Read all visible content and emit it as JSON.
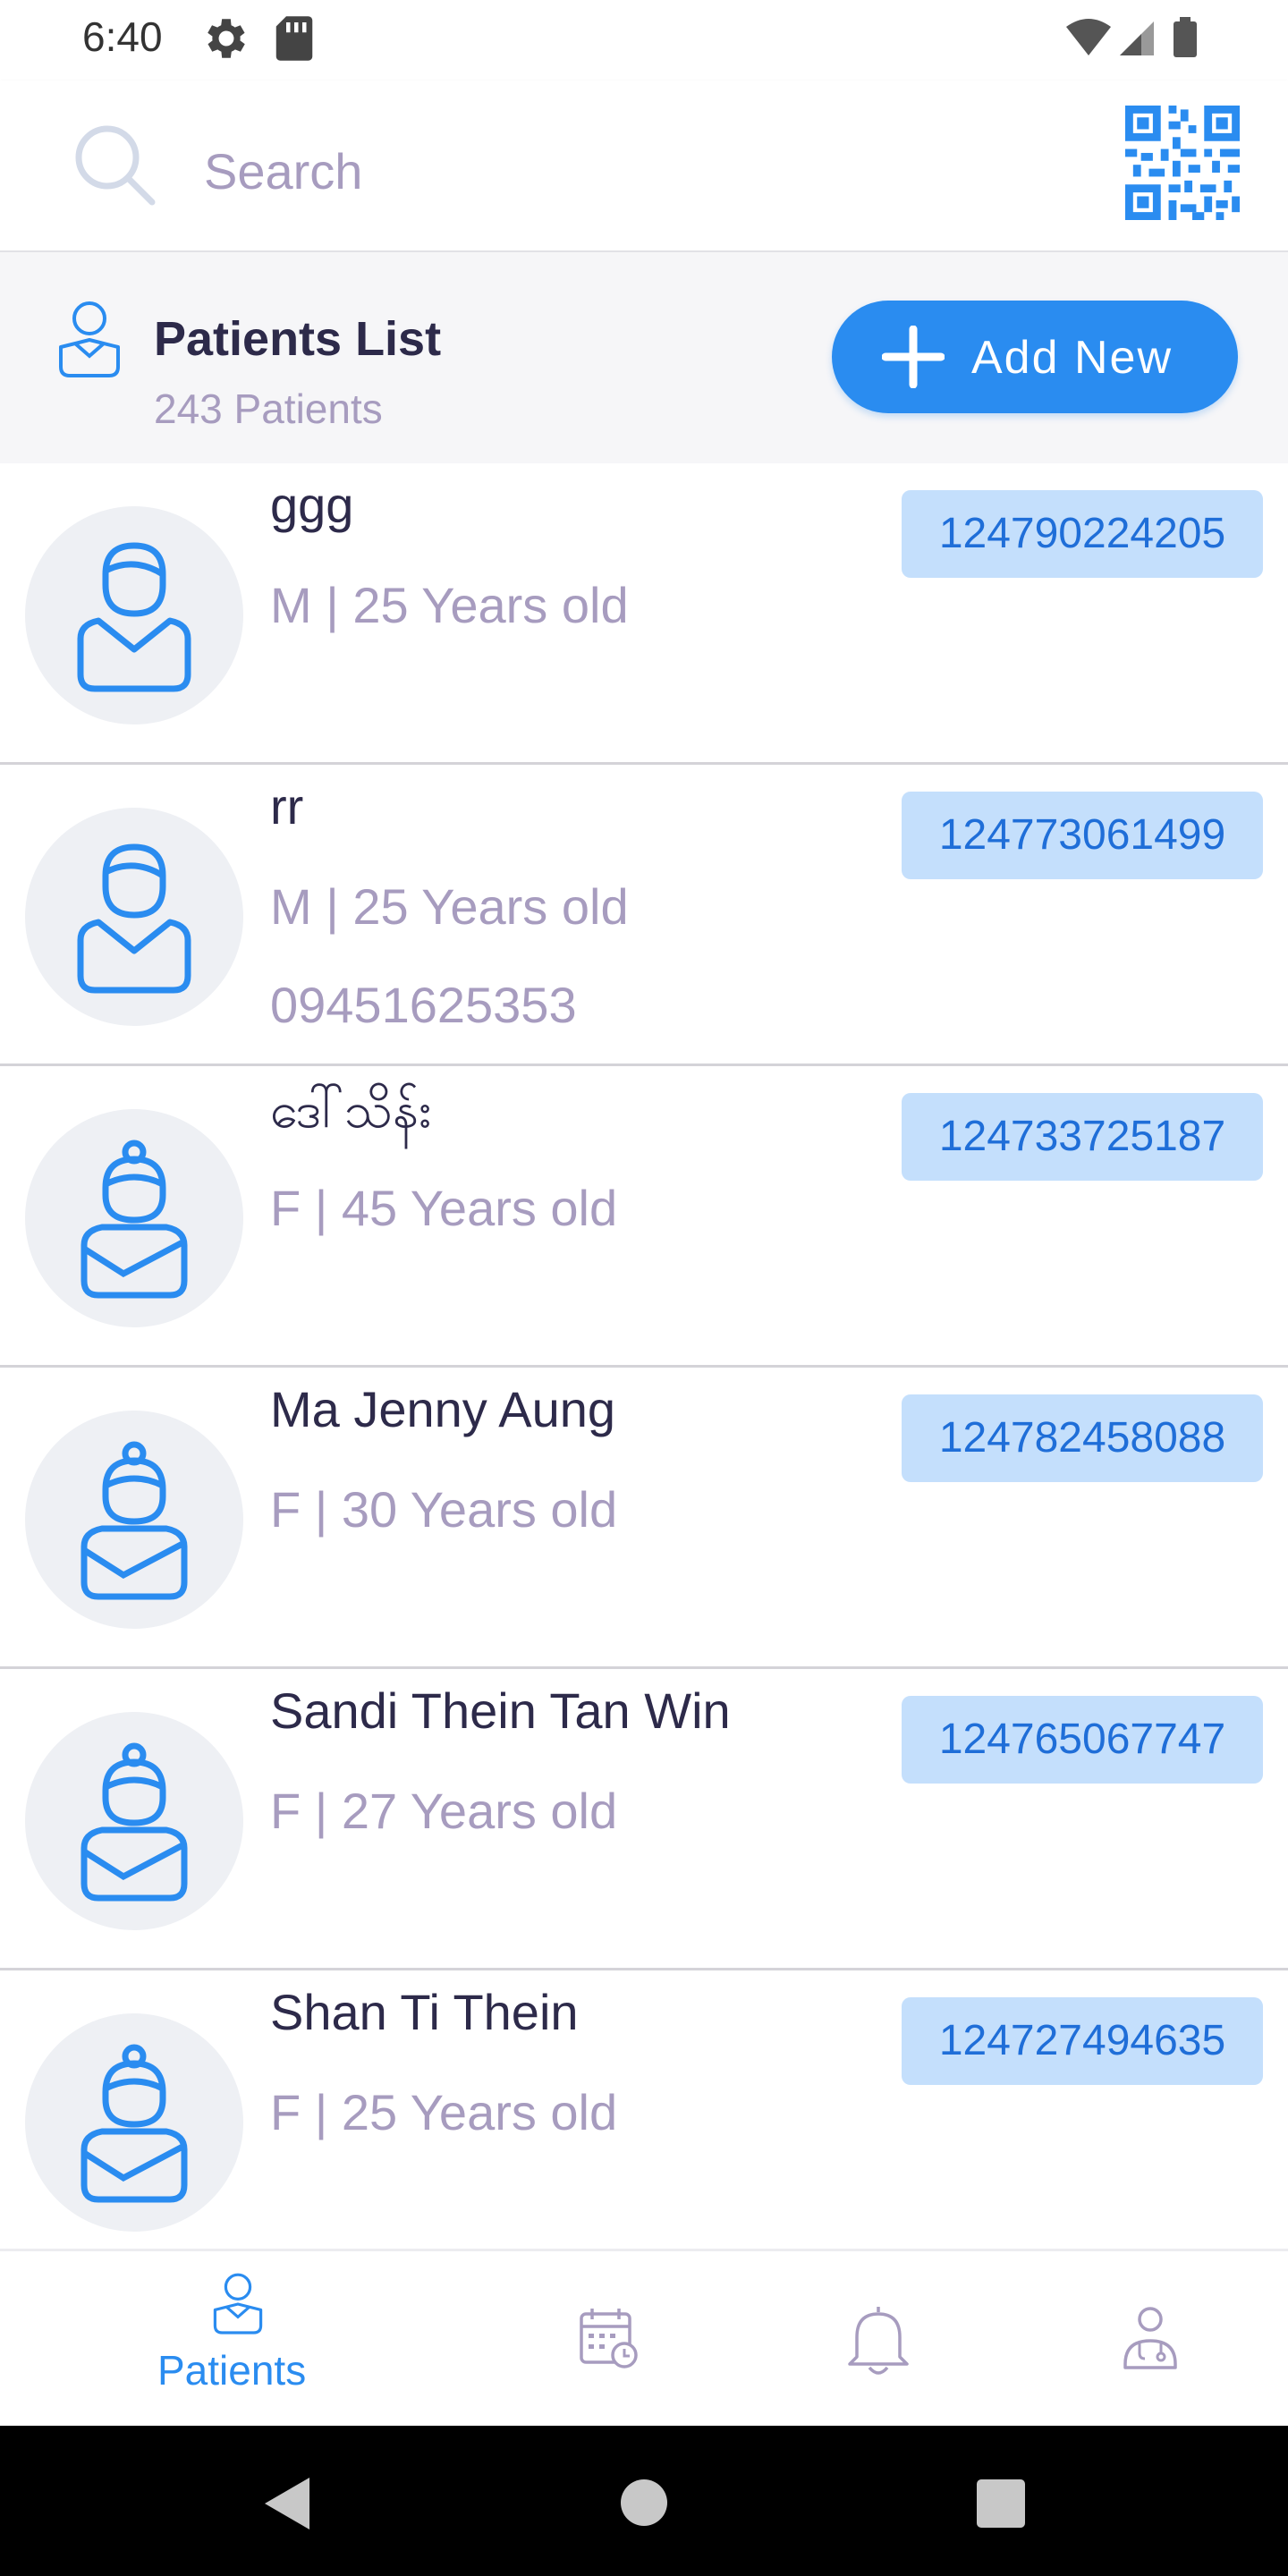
{
  "status_bar": {
    "time": "6:40",
    "left_icons": [
      "gear-icon",
      "sd-card-icon"
    ],
    "right_icons": [
      "wifi-icon",
      "signal-icon",
      "battery-icon"
    ]
  },
  "search": {
    "placeholder": "Search",
    "qr_icon": "qr-code-icon"
  },
  "list_header": {
    "title": "Patients List",
    "count": "243 Patients",
    "add_button_label": "Add New"
  },
  "patients": [
    {
      "name": "ggg",
      "meta": "M | 25 Years old",
      "phone": "",
      "id": "124790224205",
      "avatar": "male"
    },
    {
      "name": "rr",
      "meta": "M | 25 Years old",
      "phone": "09451625353",
      "id": "124773061499",
      "avatar": "male"
    },
    {
      "name": "ဒေါ်သိန်း",
      "meta": "F | 45 Years old",
      "phone": "",
      "id": "124733725187",
      "avatar": "female"
    },
    {
      "name": "Ma Jenny Aung",
      "meta": "F | 30 Years old",
      "phone": "",
      "id": "124782458088",
      "avatar": "female"
    },
    {
      "name": "Sandi Thein Tan Win",
      "meta": "F | 27 Years old",
      "phone": "",
      "id": "124765067747",
      "avatar": "female"
    },
    {
      "name": "Shan Ti Thein",
      "meta": "F | 25 Years old",
      "phone": "",
      "id": "124727494635",
      "avatar": "female"
    }
  ],
  "bottom_nav": {
    "items": [
      {
        "label": "Patients",
        "icon": "patient-icon",
        "active": true
      },
      {
        "label": "",
        "icon": "calendar-clock-icon",
        "active": false
      },
      {
        "label": "",
        "icon": "bell-icon",
        "active": false
      },
      {
        "label": "",
        "icon": "doctor-icon",
        "active": false
      }
    ]
  },
  "colors": {
    "accent": "#2a8cf0",
    "id_badge_bg": "#c4dffc",
    "muted_text": "#a79cbf",
    "primary_text": "#2d2a4a",
    "header_bg": "#f6f6f8",
    "avatar_bg": "#eef0f4"
  }
}
